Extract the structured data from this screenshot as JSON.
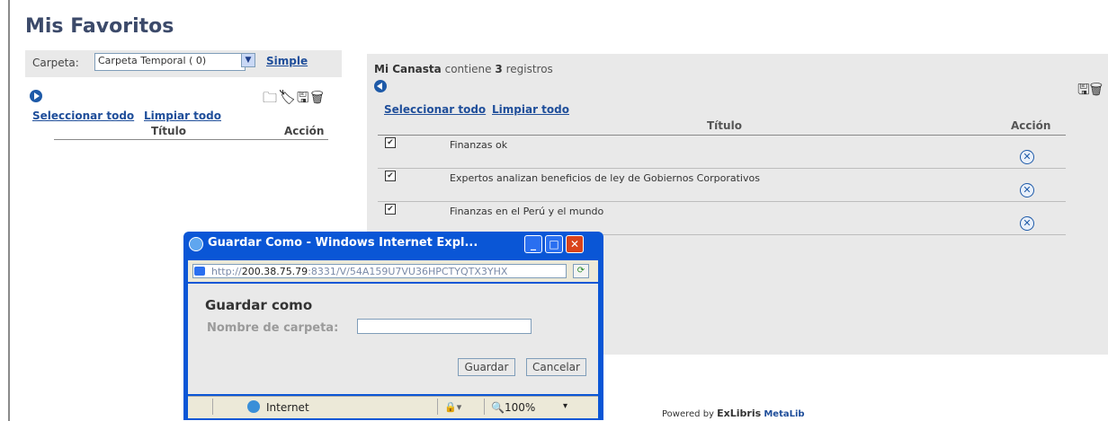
{
  "page": {
    "title": "Mis Favoritos"
  },
  "left_panel": {
    "carpeta_label": "Carpeta:",
    "carpeta_value": "Carpeta Temporal ( 0)",
    "simple_link": "Simple",
    "select_all": "Seleccionar todo",
    "clear_all": "Limpiar todo",
    "col_titulo": "Título",
    "col_accion": "Acción",
    "toolbar_icons": [
      "new-folder-icon",
      "tag-icon",
      "save-icon",
      "delete-icon"
    ]
  },
  "basket": {
    "title_prefix": "Mi Canasta",
    "title_mid": "contiene",
    "count": "3",
    "title_suffix": "registros",
    "select_all": "Seleccionar todo",
    "clear_all": "Limpiar todo",
    "col_titulo": "Título",
    "col_accion": "Acción",
    "rows": [
      {
        "title": "Finanzas ok",
        "checked": true
      },
      {
        "title": "Expertos analizan beneficios de ley de Gobiernos Corporativos",
        "checked": true
      },
      {
        "title": "Finanzas en el Perú y el mundo",
        "checked": true
      }
    ]
  },
  "powered_by": {
    "prefix": "Powered by",
    "brand": "ExLibris",
    "product": "MetaLib"
  },
  "popup": {
    "window_title": "Guardar Como - Windows Internet Expl...",
    "address_prefix": "http://",
    "address_host": "200.38.75.79",
    "address_rest": ":8331/V/54A159U7VU36HPCTYQTX3YHX",
    "heading": "Guardar como",
    "folder_label": "Nombre de carpeta:",
    "folder_value": "",
    "btn_save": "Guardar",
    "btn_cancel": "Cancelar",
    "status_zone": "Internet",
    "status_zoom": "100%"
  }
}
